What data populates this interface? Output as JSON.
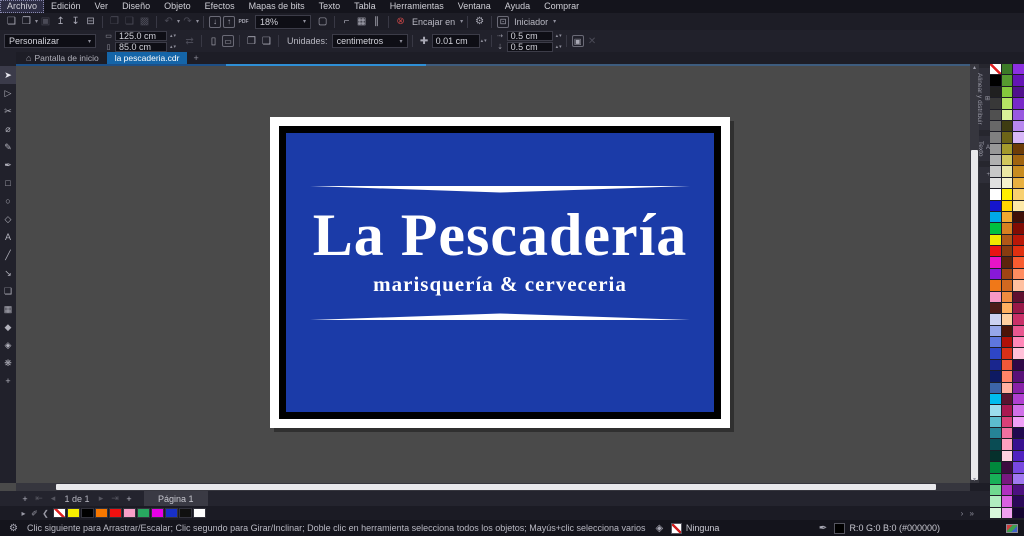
{
  "menu": {
    "items": [
      {
        "label": "Archivo",
        "cls": "active"
      },
      {
        "label": "Edición"
      },
      {
        "label": "Ver"
      },
      {
        "label": "Diseño"
      },
      {
        "label": "Objeto"
      },
      {
        "label": "Efectos"
      },
      {
        "label": "Mapas de bits"
      },
      {
        "label": "Texto"
      },
      {
        "label": "Tabla"
      },
      {
        "label": "Herramientas"
      },
      {
        "label": "Ventana"
      },
      {
        "label": "Ayuda"
      },
      {
        "label": "Comprar"
      }
    ]
  },
  "toolbar": {
    "zoom_value": "18%",
    "snap_label": "Encajar en",
    "launcher_label": "Iniciador",
    "icons": {
      "new_doc": "❑",
      "open": "❒",
      "save": "▣",
      "upload": "↥",
      "download": "↧",
      "print": "⊟",
      "copy": "❐",
      "paste": "❑",
      "group": "▩",
      "undo": "↶",
      "redo": "↷",
      "import": "↓",
      "export": "↑",
      "pdf": "PDF",
      "fullscreen": "▢",
      "rulers": "⌐",
      "grid": "▦",
      "guides": "∥",
      "snap_off": "⊗",
      "gear": "⚙",
      "launcher": "⊡",
      "caret": "▾"
    }
  },
  "property_bar": {
    "preset": "Personalizar",
    "page_width": "125.0 cm",
    "page_height": "85.0 cm",
    "units_label": "Unidades:",
    "units": "centimetros",
    "nudge": "0.01 cm",
    "dup_x": "0.5 cm",
    "dup_y": "0.5 cm",
    "icons": {
      "width_ic": "▭",
      "height_ic": "▯",
      "swap": "⇄",
      "portrait": "▯",
      "landscape": "▭",
      "all_pages": "❐",
      "current_page": "❏",
      "nudge_ic": "✚",
      "dupx_ic": "⇢",
      "dupy_ic": "⇣",
      "treat_filled": "▣",
      "extra": "✕",
      "spin_up": "▴",
      "spin_dn": "▾"
    }
  },
  "tabs": {
    "home": "Pantalla de inicio",
    "doc": "la pescaderia.cdr",
    "icons": {
      "home": "⌂",
      "add": "+"
    }
  },
  "toolbox": [
    {
      "name": "pick-tool",
      "glyph": "➤",
      "cls": "active"
    },
    {
      "name": "shape-tool",
      "glyph": "▷"
    },
    {
      "name": "crop-tool",
      "glyph": "✂"
    },
    {
      "name": "zoom-tool",
      "glyph": "⌀"
    },
    {
      "name": "freehand-tool",
      "glyph": "✎"
    },
    {
      "name": "artistic-media-tool",
      "glyph": "✒"
    },
    {
      "name": "rectangle-tool",
      "glyph": "□"
    },
    {
      "name": "ellipse-tool",
      "glyph": "○"
    },
    {
      "name": "polygon-tool",
      "glyph": "◇"
    },
    {
      "name": "text-tool",
      "glyph": "A"
    },
    {
      "name": "dimension-tool",
      "glyph": "╱"
    },
    {
      "name": "connector-tool",
      "glyph": "↘"
    },
    {
      "name": "drop-shadow-tool",
      "glyph": "❏"
    },
    {
      "name": "transparency-tool",
      "glyph": "▦"
    },
    {
      "name": "eyedropper-tool",
      "glyph": "◆"
    },
    {
      "name": "interactive-fill-tool",
      "glyph": "◈"
    },
    {
      "name": "smart-fill-tool",
      "glyph": "❋"
    },
    {
      "name": "add-tool",
      "glyph": "+"
    }
  ],
  "dockers": {
    "tabs": [
      {
        "name": "docker-tab-align",
        "glyph": "⊞",
        "label": "Alinear y distribuir"
      },
      {
        "name": "docker-tab-text",
        "glyph": "A",
        "label": "Texto"
      },
      {
        "name": "docker-add-button",
        "glyph": "+",
        "label": ""
      }
    ]
  },
  "canvas": {
    "logo": {
      "title": "La Pescadería",
      "subtitle": "marisquería & cerveceria",
      "bg_color": "#1b3ba8",
      "frame_color": "#000000",
      "border_color": "#ffffff"
    }
  },
  "palette_main": [
    "none",
    "#000000",
    "#202020",
    "#383838",
    "#505050",
    "#686868",
    "#808080",
    "#989898",
    "#b0b0b0",
    "#c8c8c8",
    "#e0e0e0",
    "#ffffff",
    "#1515cc",
    "#00a8e8",
    "#00c040",
    "#f0e800",
    "#e81414",
    "#e814c8",
    "#8818d8",
    "#f07818",
    "#f898c4",
    "#4c1c18",
    "#ccd2f2",
    "#96a6ea",
    "#5e76de",
    "#2e46c6",
    "#1a268e",
    "#0e1a62",
    "#3c64a8",
    "#00bcee",
    "#9cdcec",
    "#5cbcce",
    "#268496",
    "#0a4c54",
    "#06302c",
    "#00883c",
    "#18b058",
    "#70d890",
    "#b0ecc0",
    "#d8f8dc",
    "#3c7a28",
    "#569a30",
    "#84c83c",
    "#b4e464",
    "#d8f098",
    "#3e3c12",
    "#6c6418",
    "#a49a2c",
    "#d2c85c",
    "#ece8a4",
    "#f6f2cc",
    "#ffee00",
    "#ffd400",
    "#f0a830",
    "#d88020",
    "#b05818",
    "#883c10",
    "#5c240c",
    "#a04414",
    "#d06820",
    "#f08c40",
    "#ffb060",
    "#ffd0a0",
    "#4c1408",
    "#b01008",
    "#d83018",
    "#f05838",
    "#ff8468",
    "#ffb0a0",
    "#581430",
    "#a81850",
    "#d84078",
    "#f070a0",
    "#ffa0c0",
    "#ffd0e0",
    "#3c0c40",
    "#781880",
    "#b030c0",
    "#d860e0",
    "#f0a0f0",
    "#8c30e0",
    "#6414b4",
    "#50108c",
    "#7828c8",
    "#9858e0",
    "#b888f0",
    "#d8b8f8",
    "#6c3c08",
    "#a06410",
    "#c88c20",
    "#e8b040",
    "#f8d070",
    "#fce8a8",
    "#401008",
    "#800c04",
    "#b81808",
    "#e03010",
    "#f85c30",
    "#ff8c60",
    "#ffc0a0",
    "#601030",
    "#981848",
    "#c83068",
    "#e85890",
    "#ff88b8",
    "#ffc0d8",
    "#300848",
    "#581078",
    "#8820a8",
    "#b040d0",
    "#d070e8",
    "#f0a0f8",
    "#200850",
    "#381090",
    "#5020c0",
    "#7848e0",
    "#a078f0",
    "#4c1080",
    "#2a0858",
    "#140430"
  ],
  "page_bar": {
    "indicator": "1 de 1",
    "tab": "Página 1",
    "icons": {
      "add": "+",
      "first": "⇤",
      "prev": "◂",
      "next": "▸",
      "last": "⇥"
    }
  },
  "doc_palette_bar": {
    "icons": {
      "flyout": "▸",
      "eyedropper": "✐",
      "left": "❮",
      "more": "› »"
    },
    "colors": [
      "none",
      "#f8f000",
      "#000000",
      "#f87800",
      "#f01010",
      "#f8a0c8",
      "#28a860",
      "#e800e8",
      "#1830c8",
      "#101010",
      "#ffffff"
    ]
  },
  "status_bar": {
    "hint": "Clic siguiente para Arrastrar/Escalar; Clic segundo para Girar/Inclinar; Doble clic en herramienta selecciona todos los objetos; Mayús+clic selecciona varios objetos; Alt+clic selecciona objetos subyacentes",
    "fill_label": "Ninguna",
    "color_label": "R:0 G:0 B:0 (#000000)",
    "icons": {
      "gear": "⚙",
      "pen": "✒",
      "fill": "◈"
    }
  }
}
